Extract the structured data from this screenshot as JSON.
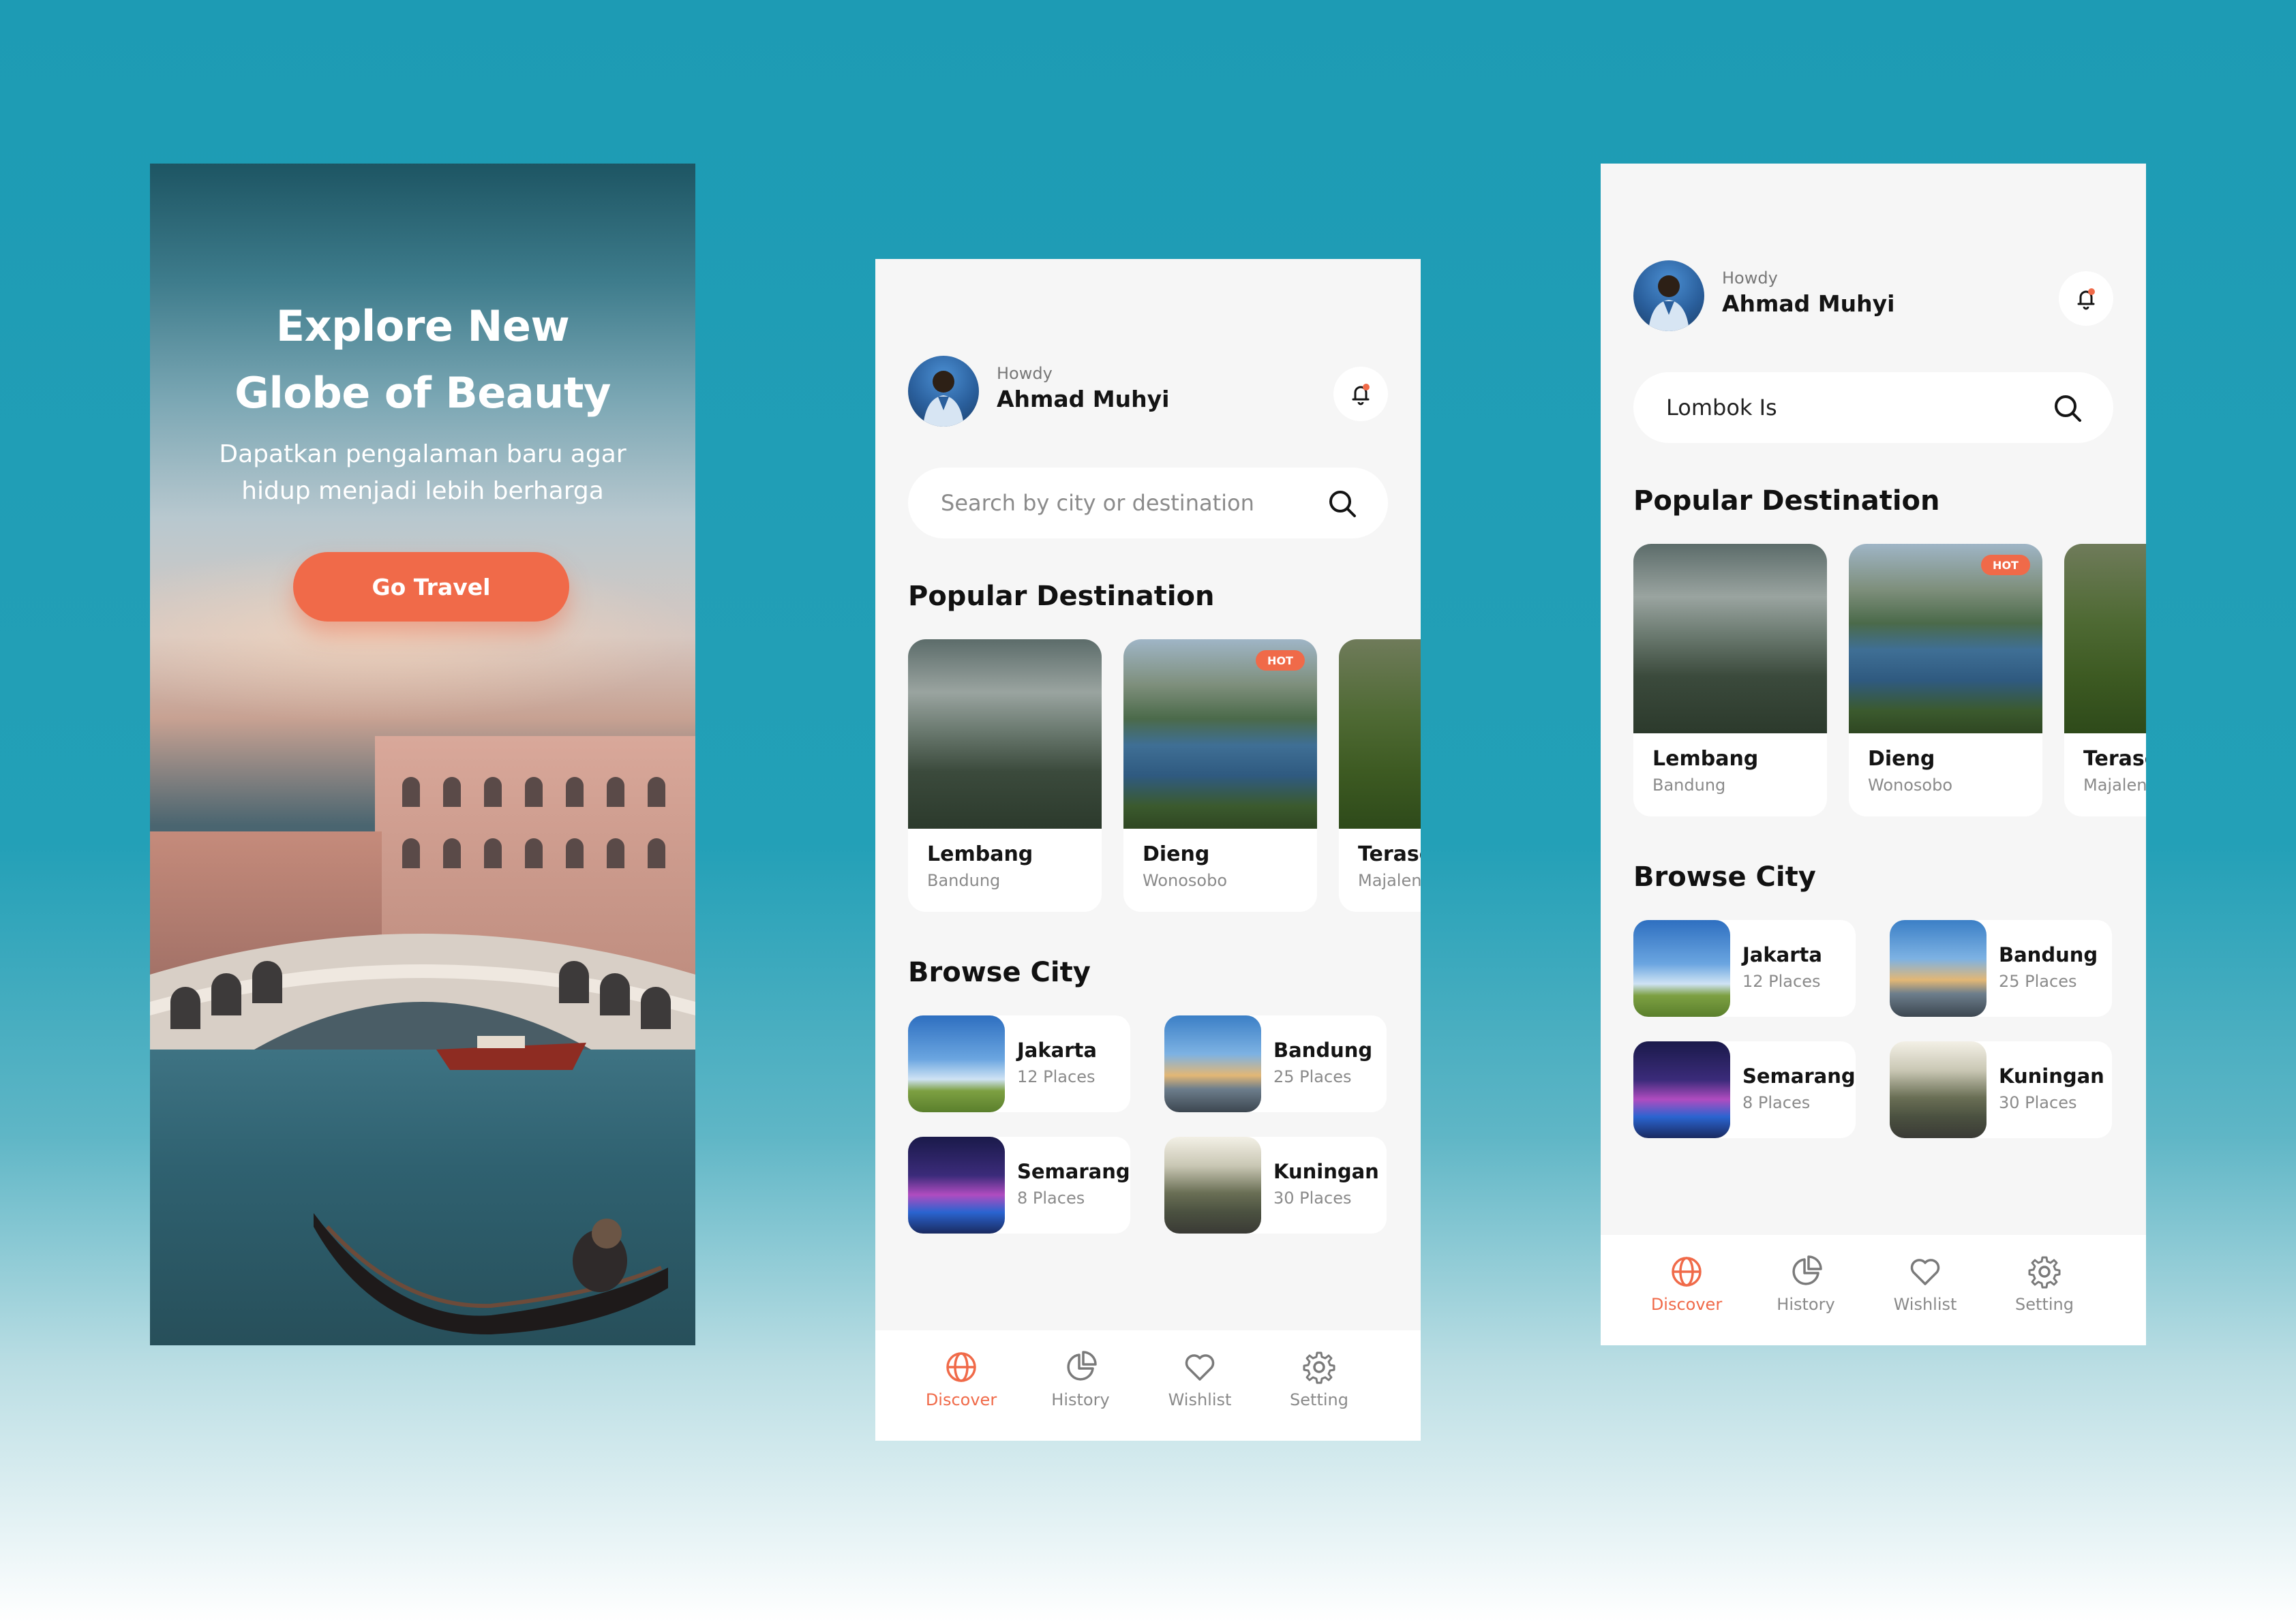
{
  "splash": {
    "title_line1": "Explore New",
    "title_line2": "Globe of Beauty",
    "subtitle_line1": "Dapatkan pengalaman baru agar",
    "subtitle_line2": "hidup menjadi lebih berharga",
    "cta_label": "Go Travel"
  },
  "home": {
    "header": {
      "greeting": "Howdy",
      "user_name": "Ahmad Muhyi"
    },
    "search": {
      "placeholder": "Search by city or destination",
      "value": ""
    },
    "popular_title": "Popular Destination",
    "destinations": [
      {
        "name": "Lembang",
        "location": "Bandung",
        "badge": ""
      },
      {
        "name": "Dieng",
        "location": "Wonosobo",
        "badge": "HOT"
      },
      {
        "name": "Terase",
        "location": "Majalen",
        "badge": ""
      }
    ],
    "browse_title": "Browse City",
    "cities": [
      {
        "name": "Jakarta",
        "count": "12 Places"
      },
      {
        "name": "Bandung",
        "count": "25 Places"
      },
      {
        "name": "Semarang",
        "count": "8 Places"
      },
      {
        "name": "Kuningan",
        "count": "30 Places"
      }
    ],
    "nav": [
      {
        "label": "Discover",
        "icon": "globe-icon",
        "active": true
      },
      {
        "label": "History",
        "icon": "pie-chart-icon",
        "active": false
      },
      {
        "label": "Wishlist",
        "icon": "heart-icon",
        "active": false
      },
      {
        "label": "Setting",
        "icon": "gear-icon",
        "active": false
      }
    ]
  },
  "search_screen": {
    "header": {
      "greeting": "Howdy",
      "user_name": "Ahmad Muhyi"
    },
    "search": {
      "placeholder": "Search by city or destination",
      "value": "Lombok Is"
    },
    "popular_title": "Popular Destination",
    "destinations": [
      {
        "name": "Lembang",
        "location": "Bandung",
        "badge": ""
      },
      {
        "name": "Dieng",
        "location": "Wonosobo",
        "badge": "HOT"
      },
      {
        "name": "Terase",
        "location": "Majalen",
        "badge": ""
      }
    ],
    "browse_title": "Browse City",
    "cities": [
      {
        "name": "Jakarta",
        "count": "12 Places"
      },
      {
        "name": "Bandung",
        "count": "25 Places"
      },
      {
        "name": "Semarang",
        "count": "8 Places"
      },
      {
        "name": "Kuningan",
        "count": "30 Places"
      }
    ],
    "nav": [
      {
        "label": "Discover",
        "icon": "globe-icon",
        "active": true
      },
      {
        "label": "History",
        "icon": "pie-chart-icon",
        "active": false
      },
      {
        "label": "Wishlist",
        "icon": "heart-icon",
        "active": false
      },
      {
        "label": "Setting",
        "icon": "gear-icon",
        "active": false
      }
    ]
  },
  "colors": {
    "accent": "#f06a49",
    "background_teal": "#1d9bb4",
    "surface": "#f6f6f6",
    "card": "#ffffff",
    "text_primary": "#141414",
    "text_secondary": "#8a8a8a"
  }
}
